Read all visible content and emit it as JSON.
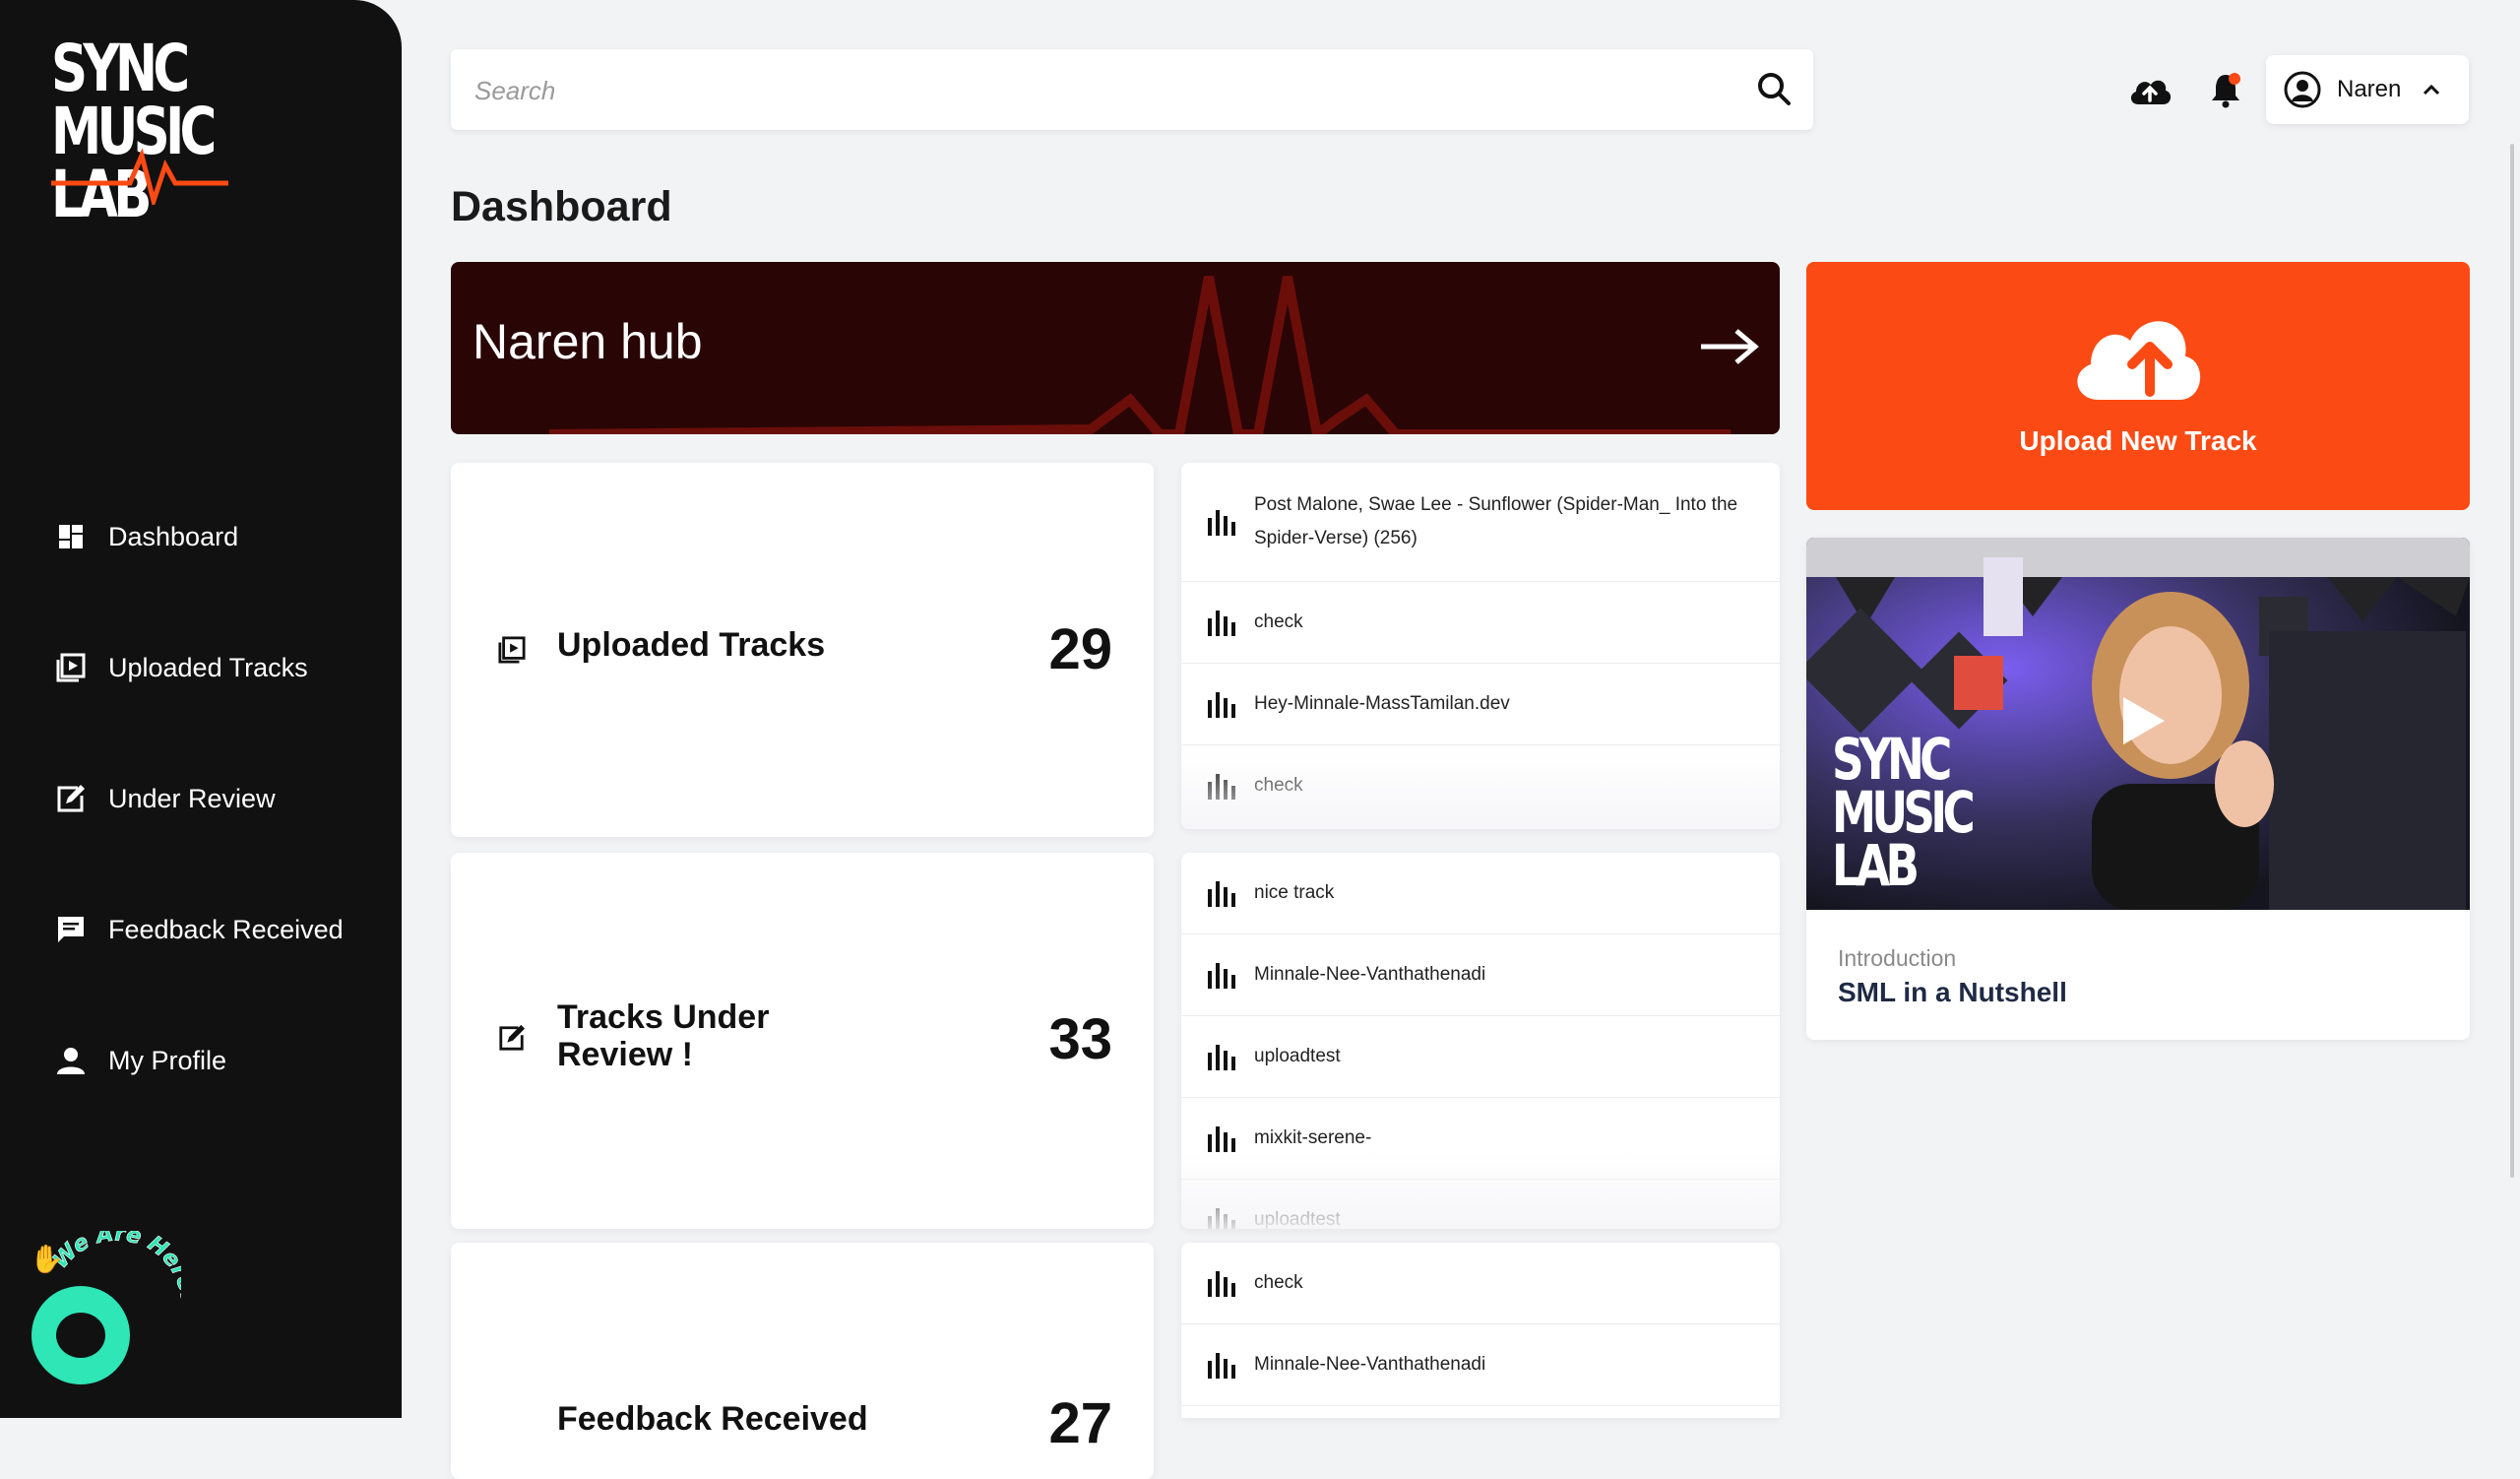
{
  "brand": {
    "logo_lines": [
      "SYNC",
      "MUSIC",
      "LAB"
    ]
  },
  "sidebar": {
    "items": [
      {
        "label": "Dashboard",
        "icon": "dashboard-icon"
      },
      {
        "label": "Uploaded Tracks",
        "icon": "uploaded-tracks-icon"
      },
      {
        "label": "Under Review",
        "icon": "under-review-icon"
      },
      {
        "label": "Feedback Received",
        "icon": "feedback-icon"
      },
      {
        "label": "My Profile",
        "icon": "profile-icon"
      }
    ],
    "chat_widget_text": "We Are Here!"
  },
  "topbar": {
    "search_placeholder": "Search",
    "user_name": "Naren"
  },
  "page": {
    "title": "Dashboard"
  },
  "hub": {
    "title": "Naren hub"
  },
  "upload_card": {
    "label": "Upload New Track"
  },
  "video": {
    "kicker": "Introduction",
    "title": "SML in a Nutshell",
    "thumb_logo": [
      "SYNC",
      "MUSIC",
      "LAB"
    ]
  },
  "stats": [
    {
      "label": "Uploaded Tracks",
      "count": "29"
    },
    {
      "label": "Tracks Under Review !",
      "count": "33"
    },
    {
      "label": "Feedback Received",
      "count": "27"
    }
  ],
  "lists": {
    "uploaded": [
      "Post Malone, Swae Lee - Sunflower (Spider-Man_ Into the Spider-Verse) (256)",
      "check",
      "Hey-Minnale-MassTamilan.dev",
      "check"
    ],
    "review": [
      "nice track",
      "Minnale-Nee-Vanthathenadi",
      "uploadtest",
      "mixkit-serene-",
      "uploadtest"
    ],
    "feedback": [
      "check",
      "Minnale-Nee-Vanthathenadi"
    ]
  },
  "colors": {
    "accent": "#fc4a14",
    "sidebar_bg": "#111111",
    "hub_bg": "#2a0505",
    "chat": "#2ee6b6"
  }
}
